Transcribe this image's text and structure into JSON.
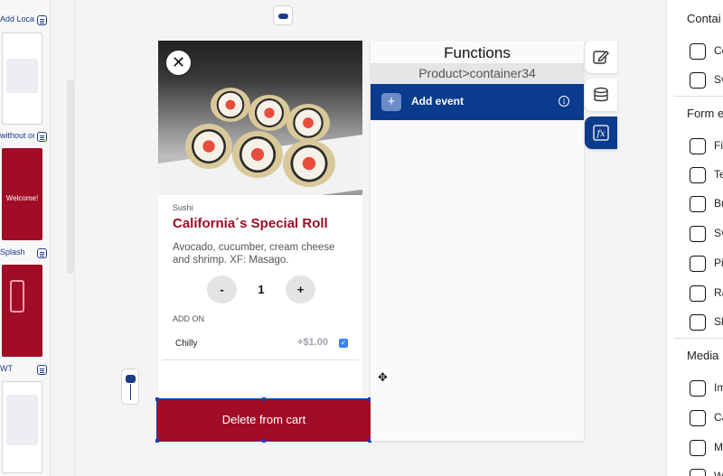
{
  "pages": [
    {
      "label": "Add Locati",
      "name": "add-location"
    },
    {
      "label": "without on",
      "name": "without-onboarding"
    },
    {
      "label": "Splash",
      "name": "splash"
    },
    {
      "label": "WT",
      "name": "wt"
    }
  ],
  "thumbnails": {
    "welcome_text": "Welcome!"
  },
  "product": {
    "category": "Sushi",
    "title": "California´s Special Roll",
    "description": "Avocado, cucumber, cream cheese and shrimp. XF: Masago.",
    "quantity": "1",
    "minus_label": "-",
    "plus_label": "+",
    "addon_header": "ADD ON",
    "addons": [
      {
        "name": "Chilly",
        "price": "+$1.00",
        "checked": true
      }
    ],
    "delete_label": "Delete from cart",
    "close_symbol": "✕"
  },
  "functions": {
    "title": "Functions",
    "path": "Product>container34",
    "add_event_label": "Add event",
    "add_event_symbol": "+",
    "info_symbol": "i"
  },
  "side_tabs": [
    {
      "name": "edit-icon",
      "active": false
    },
    {
      "name": "database-icon",
      "active": false
    },
    {
      "name": "function-fx-icon",
      "active": true
    }
  ],
  "widgets": {
    "sections": [
      {
        "title": "Contai",
        "items": [
          "Co",
          "Sv"
        ]
      },
      {
        "title": "Form e",
        "items": [
          "Fi",
          "Te",
          "Bu",
          "Sv",
          "Pi",
          "Ra",
          "Sl"
        ]
      },
      {
        "title": "Media",
        "items": [
          "Im",
          "Ca",
          "M",
          "W"
        ]
      }
    ]
  },
  "colors": {
    "brand_red": "#a10d26",
    "primary_blue": "#0b3b8c",
    "title_red": "#9b0d25"
  }
}
